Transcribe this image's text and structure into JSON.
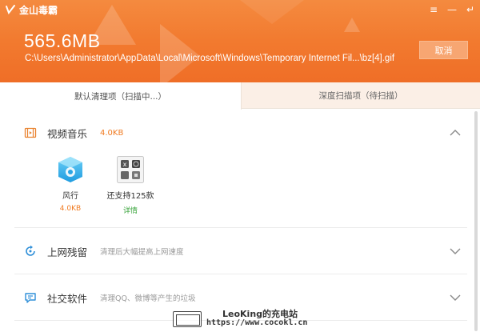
{
  "app": {
    "logo_text": "金山毒霸"
  },
  "window_controls": {
    "menu": "≡",
    "minimize": "—",
    "back": "↵"
  },
  "header": {
    "size_text": "565.6MB",
    "path_text": "C:\\Users\\Administrator\\AppData\\Local\\Microsoft\\Windows\\Temporary Internet Fil...\\bz[4].gif",
    "cancel_label": "取消"
  },
  "tabs": [
    {
      "label": "默认清理项（扫描中...）",
      "active": true
    },
    {
      "label": "深度扫描项（待扫描）",
      "active": false
    }
  ],
  "sections": {
    "video_music": {
      "title": "视频音乐",
      "size": "4.0KB",
      "expanded": true,
      "items": [
        {
          "name": "风行",
          "size": "4.0KB",
          "icon": "fengxing-icon"
        },
        {
          "name": "还支持125款",
          "detail": "详情",
          "icon": "app-grid-icon"
        }
      ]
    },
    "web_traces": {
      "title": "上网残留",
      "subtitle": "清理后大幅提高上网速度",
      "expanded": false
    },
    "social": {
      "title": "社交软件",
      "subtitle": "清理QQ、微博等产生的垃圾",
      "expanded": false
    }
  },
  "watermark": {
    "line1": "LeoKing的充电站",
    "line2": "https://www.cocokl.cn"
  },
  "colors": {
    "header_orange": "#f27a2f",
    "accent_orange": "#f07b22",
    "detail_green": "#3aa43c"
  }
}
